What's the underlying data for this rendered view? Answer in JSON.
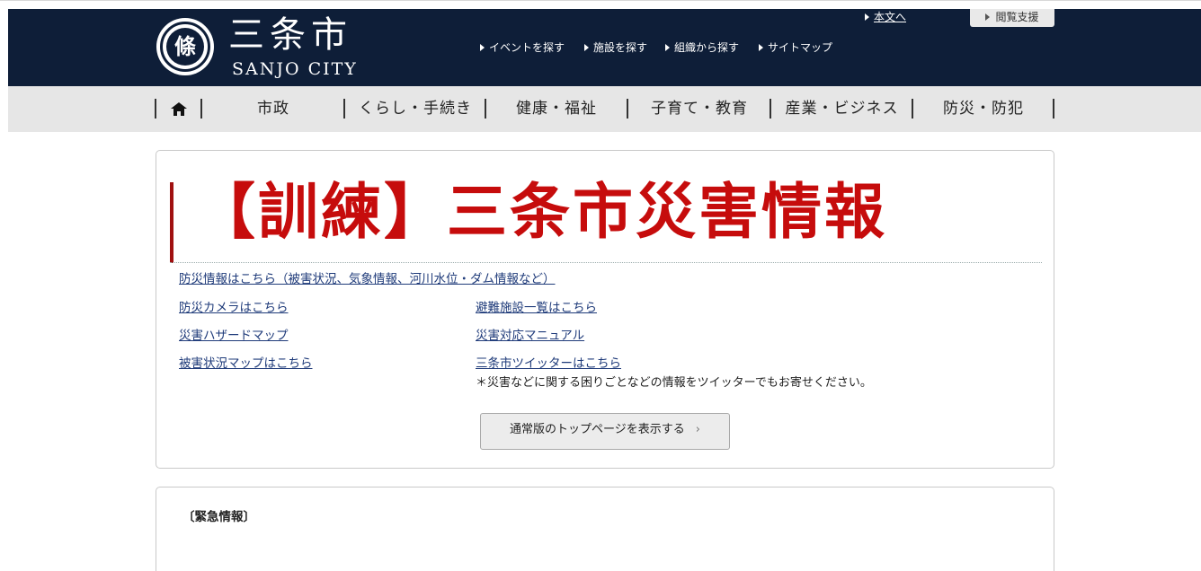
{
  "header": {
    "logo_crest_glyph": "條",
    "logo_ja": "三条市",
    "logo_en": "SANJO CITY",
    "skip_link": "本文へ",
    "accessibility_button": "閲覧支援",
    "util_links": [
      "イベントを探す",
      "施設を探す",
      "組織から探す",
      "サイトマップ"
    ],
    "background_color": "#0e1e38"
  },
  "nav": {
    "home_icon": "home-icon",
    "items": [
      "市政",
      "くらし・手続き",
      "健康・福祉",
      "子育て・教育",
      "産業・ビジネス",
      "防災・防犯"
    ]
  },
  "disaster": {
    "title": "【訓練】三条市災害情報",
    "title_color": "#c60c0c",
    "link_main": "防災情報はこちら（被害状況、気象情報、河川水位・ダム情報など）",
    "link_camera": "防災カメラはこちら",
    "link_shelters": "避難施設一覧はこちら",
    "link_hazard_map": "災害ハザードマップ",
    "link_manual": "災害対応マニュアル",
    "link_damage_map": "被害状況マップはこちら",
    "link_twitter": "三条市ツイッターはこちら",
    "twitter_note": "＊災害などに関する困りごとなどの情報をツイッターでもお寄せください。",
    "top_page_button": "通常版のトップページを表示する",
    "top_page_button_chevron": "chevron-right-icon"
  },
  "emergency": {
    "heading": "〔緊急情報〕"
  }
}
